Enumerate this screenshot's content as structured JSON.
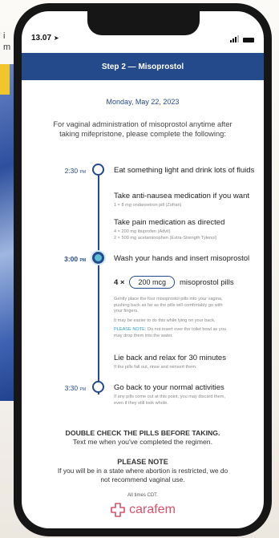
{
  "background": {
    "snippet_lines": [
      "i",
      "m"
    ]
  },
  "status_bar": {
    "time": "13.07",
    "location_arrow": "➤"
  },
  "header": {
    "title": "Step 2 — Misoprostol"
  },
  "date": "Monday, May 22, 2023",
  "intro": "For vaginal administration of misoprostol anytime after taking mifepristone, please complete the following:",
  "timeline": {
    "times": [
      {
        "label": "2:30",
        "suffix": "PM"
      },
      {
        "label": "3:00",
        "suffix": "PM"
      },
      {
        "label": "3:30",
        "suffix": "PM"
      }
    ],
    "steps": [
      {
        "title": "Eat something light and drink lots of fluids"
      },
      {
        "title": "Take anti-nausea medication if you want",
        "note": "1 × 8 mg ondansetron pill (Zofran)"
      },
      {
        "title": "Take pain medication as directed",
        "note_lines": [
          "4 × 200 mg ibuprofen (Advil)",
          "2 × 500 mg acetaminophen (Extra-Strength Tylenol)"
        ]
      },
      {
        "title": "Wash your hands and insert misoprostol"
      },
      {
        "title": "Lie back and relax for 30 minutes",
        "note": "If the pills fall out, rinse and reinsert them."
      },
      {
        "title": "Go back to your normal activities",
        "note_lines": [
          "If any pills come out at this point, you may discard them,",
          "even if they still look whole."
        ]
      }
    ],
    "dose": {
      "multiplier": "4 ×",
      "amount": "200 mcg",
      "unit": "misoprostol pills"
    },
    "insert_notes": {
      "para1_lines": [
        "Gently place the four misoprostol pills into your vagina,",
        "pushing back as far as the pills will comfortably go with",
        "your fingers."
      ],
      "para2": "It may be easier to do this while lying on your back.",
      "please_note_label": "PLEASE NOTE:",
      "please_note_text_1": " Do not insert over the toilet bowl as you",
      "please_note_text_2": "may drop them into the water."
    }
  },
  "closing": {
    "heading": "DOUBLE CHECK THE PILLS BEFORE TAKING.",
    "text": "Text me when you've completed the regimen."
  },
  "please_note": {
    "heading": "PLEASE NOTE",
    "line1": "If you will be in a state where abortion is restricted, we do",
    "line2": "not recommend vaginal use."
  },
  "timezone": "All times CDT.",
  "brand": {
    "name": "carafem",
    "color": "#d8506a"
  },
  "colors": {
    "primary": "#244a8c",
    "accent": "#5cc0d8"
  }
}
